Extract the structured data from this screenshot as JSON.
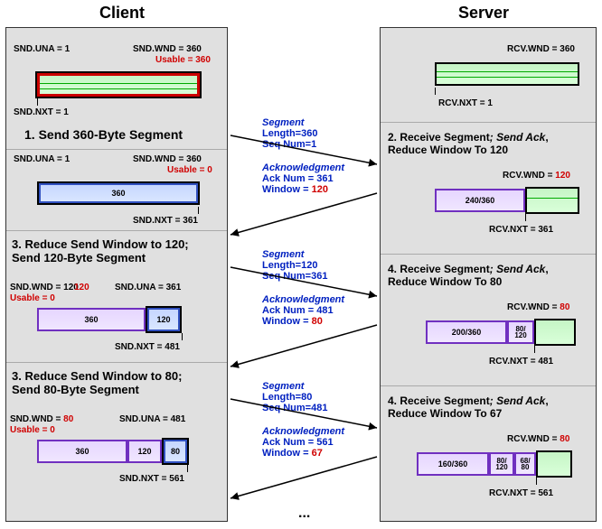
{
  "titles": {
    "client": "Client",
    "server": "Server"
  },
  "client": {
    "s1": {
      "snd_una": "SND.UNA = 1",
      "snd_wnd": "SND.WND = 360",
      "usable": "Usable = 360",
      "snd_nxt": "SND.NXT = 1",
      "title": "1. Send 360-Byte Segment"
    },
    "s2": {
      "snd_una": "SND.UNA = 1",
      "snd_wnd": "SND.WND = 360",
      "usable": "Usable = 0",
      "seg1": "360",
      "snd_nxt": "SND.NXT = 361"
    },
    "s3": {
      "title": "3. Reduce Send Window to 120;\n     Send 120-Byte Segment",
      "snd_wnd": "SND.WND = 120",
      "usable": "Usable = 0",
      "snd_una": "SND.UNA = 361",
      "seg1": "360",
      "seg2": "120",
      "snd_nxt": "SND.NXT = 481"
    },
    "s4": {
      "title": "3. Reduce Send Window to 80;\n     Send 80-Byte Segment",
      "snd_wnd": "SND.WND = 80",
      "usable": "Usable = 0",
      "snd_una": "SND.UNA = 481",
      "seg1": "360",
      "seg2": "120",
      "seg3": "80",
      "snd_nxt": "SND.NXT = 561"
    }
  },
  "server": {
    "top": {
      "rcv_wnd": "RCV.WND = 360",
      "rcv_nxt": "RCV.NXT = 1"
    },
    "s2": {
      "title": "2. Receive Segment; Send Ack,\nReduce Window To 120",
      "rcv_wnd": "RCV.WND = 120",
      "seg1": "240/360",
      "rcv_nxt": "RCV.NXT = 361"
    },
    "s4": {
      "title": "4. Receive Segment; Send Ack,\nReduce Window To 80",
      "rcv_wnd": "RCV.WND = 80",
      "seg1": "200/360",
      "seg2a": "80/",
      "seg2b": "120",
      "rcv_nxt": "RCV.NXT = 481"
    },
    "s6": {
      "title": "4. Receive Segment; Send Ack,\nReduce Window To 67",
      "rcv_wnd": "RCV.WND = 80",
      "seg1": "160/360",
      "seg2a": "80/",
      "seg2b": "120",
      "seg3a": "68/",
      "seg3b": "80",
      "rcv_nxt": "RCV.NXT = 561"
    }
  },
  "messages": {
    "m1": {
      "label": "Segment",
      "l1": "Length=360",
      "l2": "Seq Num=1"
    },
    "m2": {
      "label": "Acknowledgment",
      "l1": "Ack Num = 361",
      "l2": "Window = 120"
    },
    "m3": {
      "label": "Segment",
      "l1": "Length=120",
      "l2": "Seq Num=361"
    },
    "m4": {
      "label": "Acknowledgment",
      "l1": "Ack Num = 481",
      "l2": "Window = 80"
    },
    "m5": {
      "label": "Segment",
      "l1": "Length=80",
      "l2": "Seq Num=481"
    },
    "m6": {
      "label": "Acknowledgment",
      "l1": "Ack Num = 561",
      "l2": "Window = 67"
    }
  },
  "ellipsis": "..."
}
